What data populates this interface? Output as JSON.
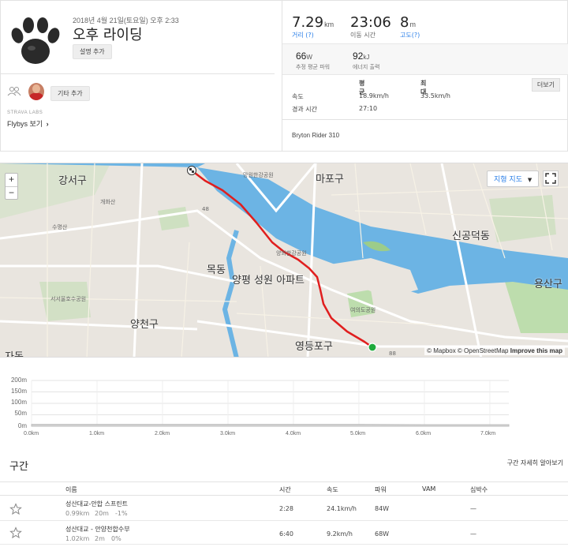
{
  "activity": {
    "date": "2018년 4월 21일(토요일) 오후 2:33",
    "title": "오후 라이딩",
    "add_description": "설명 추가",
    "add_others": "기타 추가",
    "labs": "STRAVA LABS",
    "flybys": "Flybys 보기",
    "flybys_chevron": "›"
  },
  "stats": {
    "distance": {
      "value": "7.29",
      "unit": "km",
      "label": "거리 (?)"
    },
    "moving_time": {
      "value": "23:06",
      "unit": "",
      "label": "이동 시간"
    },
    "elevation": {
      "value": "8",
      "unit": "m",
      "label": "고도(?)"
    },
    "power": {
      "value": "66",
      "unit": "W",
      "label": "추정 평균 파워"
    },
    "energy": {
      "value": "92",
      "unit": "kJ",
      "label": "에너지 출력"
    }
  },
  "detail": {
    "more_button": "더보기",
    "col_avg": "평균",
    "col_max": "최대",
    "rows": [
      {
        "label": "속도",
        "avg": "18.9km/h",
        "max": "33.5km/h"
      },
      {
        "label": "경과 시간",
        "avg": "27:10",
        "max": ""
      }
    ],
    "device": "Bryton Rider 310"
  },
  "map": {
    "map_type": "지형 지도",
    "zoom_in": "+",
    "zoom_out": "−",
    "attribution": {
      "prefix": "© Mapbox © OpenStreetMap",
      "improve": "Improve this map"
    },
    "labels_big": [
      "강서구",
      "마포구",
      "신공덕동",
      "목동",
      "양평 성원 아파트",
      "용산구",
      "양천구",
      "영등포구",
      "자동"
    ],
    "labels_small": [
      "개화산",
      "수명산",
      "망원한강공원",
      "여의도공원",
      "서서울호수공원",
      "양화한강공원",
      "88",
      "48"
    ]
  },
  "elevation_chart": {
    "yticks": [
      "200m",
      "150m",
      "100m",
      "50m",
      "0m"
    ],
    "xticks": [
      "0.0km",
      "1.0km",
      "2.0km",
      "3.0km",
      "4.0km",
      "5.0km",
      "6.0km",
      "7.0km"
    ]
  },
  "chart_data": {
    "type": "area",
    "title": "",
    "xlabel": "",
    "ylabel": "",
    "x": [
      0,
      1,
      2,
      3,
      4,
      5,
      6,
      7,
      7.29
    ],
    "y": [
      8,
      8,
      8,
      8,
      8,
      8,
      7,
      7,
      7
    ],
    "xlim": [
      0,
      7.29
    ],
    "ylim": [
      0,
      200
    ],
    "grid": true
  },
  "segments": {
    "title": "구간",
    "detail_link": "구간 자세히 알아보기",
    "headers": {
      "name": "이름",
      "time": "시간",
      "speed": "속도",
      "power": "파워",
      "vam": "VAM",
      "hr": "심박수"
    },
    "rows": [
      {
        "name": "성산대교-안합 스프린트",
        "dist": "0.99km",
        "elev": "20m",
        "grade": "-1%",
        "time": "2:28",
        "speed": "24.1km/h",
        "power": "84W",
        "vam": "",
        "hr": "—"
      },
      {
        "name": "성산대교 - 안양천합수부",
        "dist": "1.02km",
        "elev": "2m",
        "grade": "0%",
        "time": "6:40",
        "speed": "9.2km/h",
        "power": "68W",
        "vam": "",
        "hr": "—"
      }
    ]
  },
  "colors": {
    "route": "#e01e1e",
    "link": "#2a7fe8",
    "water": "#6cb4e4",
    "park": "#a6d49a"
  }
}
